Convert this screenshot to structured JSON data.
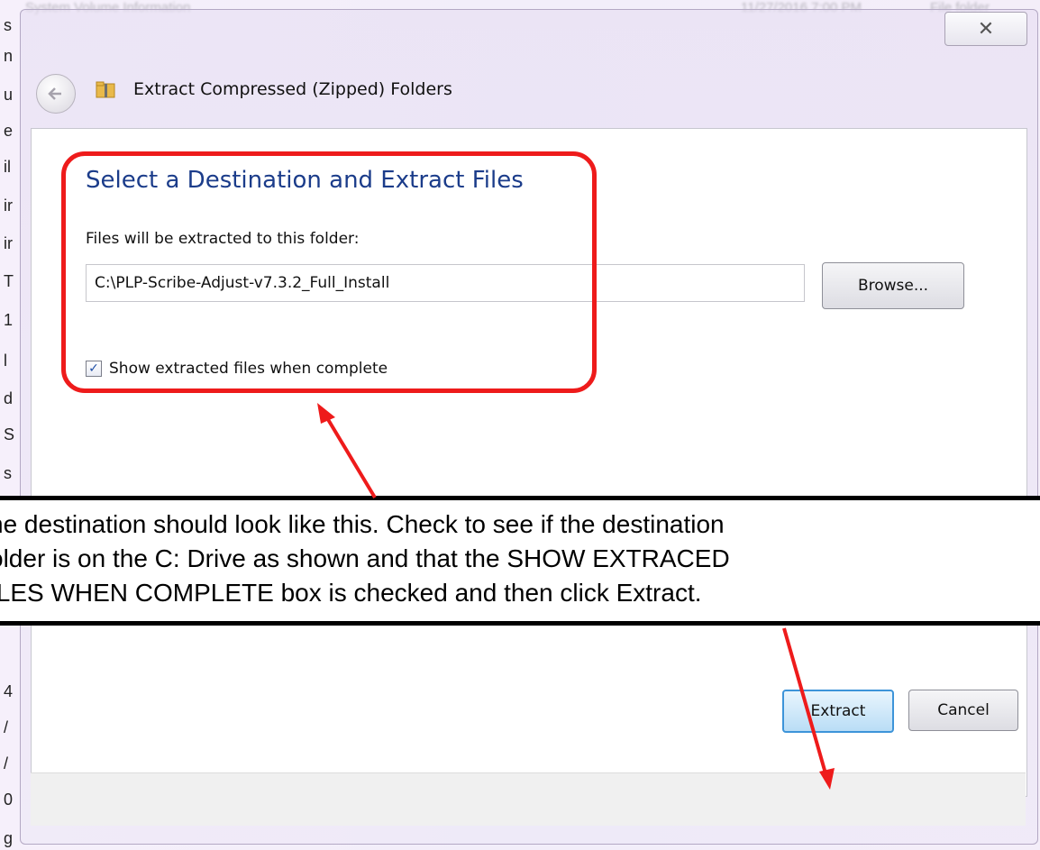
{
  "background": {
    "top_date": "11/27/2016 7:00 PM",
    "top_label": "File folder",
    "top_left_label": "System Volume Information",
    "left_letters": [
      "s",
      "n",
      "u",
      "e",
      "il",
      "ir",
      "ir",
      "T",
      "1",
      "l",
      "d",
      "S",
      "s",
      "4",
      "/",
      "/",
      "0",
      "g"
    ]
  },
  "dialog": {
    "close_glyph": "✕",
    "title": "Extract Compressed (Zipped) Folders",
    "heading": "Select a Destination and Extract Files",
    "files_label": "Files will be extracted to this folder:",
    "path_value": "C:\\PLP-Scribe-Adjust-v7.3.2_Full_Install",
    "browse_label": "Browse...",
    "checkbox_label": "Show extracted files when complete",
    "checkbox_checked": true,
    "extract_label": "Extract",
    "cancel_label": "Cancel"
  },
  "caption": {
    "text": "he destination should look like this.  Check to see if the destination\nolder is on the C: Drive as shown and that the SHOW EXTRACED\nILES WHEN COMPLETE box is checked and then click Extract."
  },
  "colors": {
    "highlight": "#ee1b1b",
    "heading": "#1b3c8a",
    "arrow": "#ee1b1b"
  }
}
